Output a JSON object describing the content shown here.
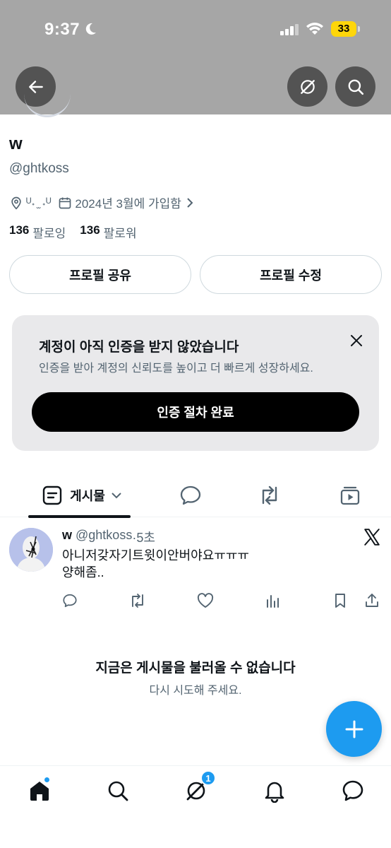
{
  "status_bar": {
    "time": "9:37",
    "battery": "33"
  },
  "profile": {
    "name": "w",
    "handle": "@ghtkoss",
    "location": "ᵁ˖ ̫ ˖ᵁ",
    "joined": "2024년 3월에 가입함",
    "following_count": "136",
    "following_label": "팔로잉",
    "followers_count": "136",
    "followers_label": "팔로워"
  },
  "buttons": {
    "share_profile": "프로필 공유",
    "edit_profile": "프로필 수정"
  },
  "verification": {
    "title": "계정이 아직 인증을 받지 않았습니다",
    "subtitle": "인증을 받아 계정의 신뢰도를 높이고 더 빠르게 성장하세요.",
    "cta": "인증 절차 완료"
  },
  "tabs": {
    "posts_label": "게시물"
  },
  "tweet": {
    "name": "w",
    "handle": "@ghtkoss",
    "time": "·5초",
    "line1": "아니저갖자기트윗이안버야요ㅠㅠㅠ",
    "line2": "양해좀.."
  },
  "error": {
    "title": "지금은 게시물을 불러올 수 없습니다",
    "subtitle": "다시 시도해 주세요."
  },
  "nav": {
    "grok_badge": "1"
  },
  "colors": {
    "accent": "#1d9bf0",
    "text": "#0f1419",
    "secondary": "#536471",
    "header_bg": "#a6a6a6",
    "card_bg": "#e9e9eb"
  }
}
